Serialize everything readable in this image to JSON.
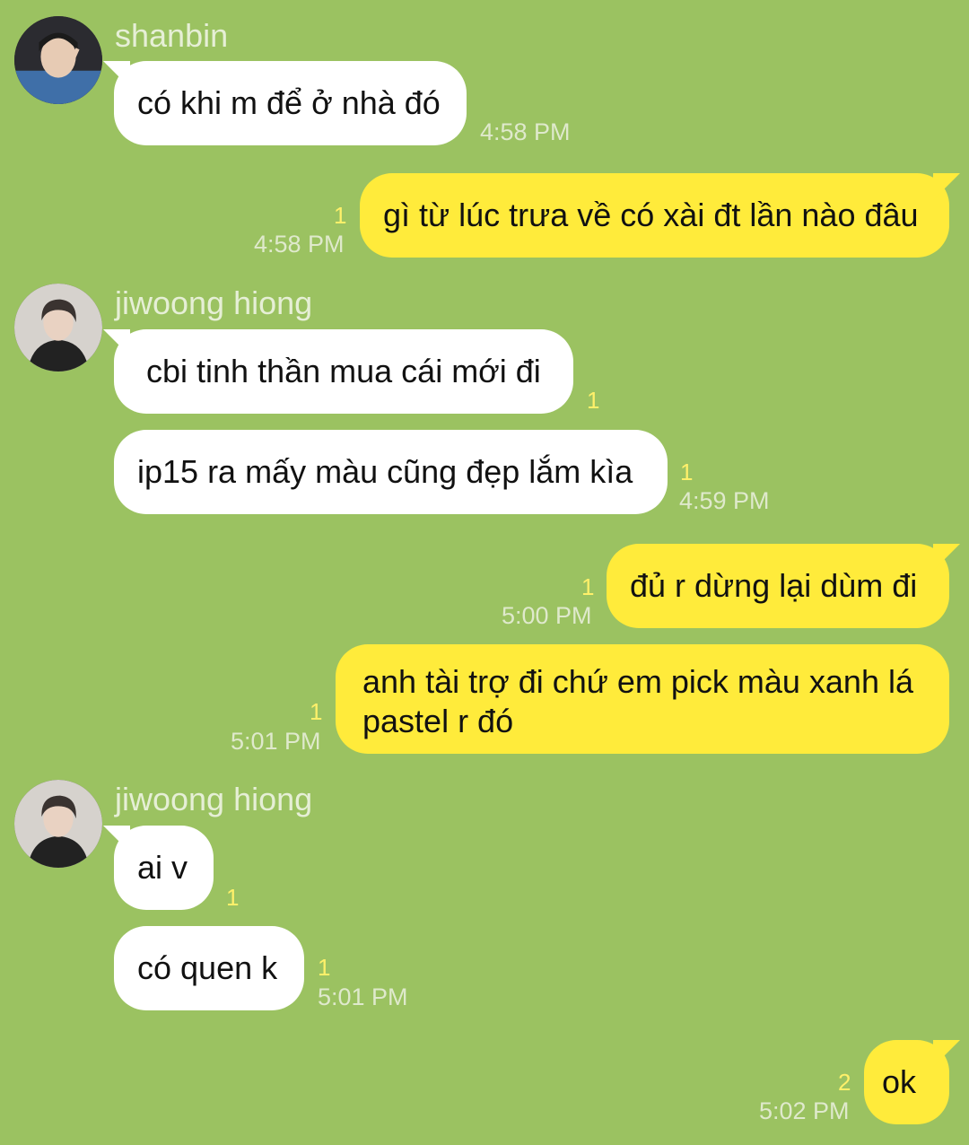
{
  "colors": {
    "background": "#9bc261",
    "incoming_bubble": "#ffffff",
    "outgoing_bubble": "#ffeb3b",
    "sender_name": "#e6efd6",
    "timestamp": "#dfe9cc",
    "read_count": "#fff06a"
  },
  "messages": [
    {
      "direction": "in",
      "sender": "shanbin",
      "avatar_icon": "user-avatar-icon",
      "text": "có khi m để ở nhà đó",
      "time": "4:58 PM",
      "read": ""
    },
    {
      "direction": "out",
      "text": "gì từ lúc trưa về có xài đt lần nào đâu",
      "time": "4:58 PM",
      "read": "1"
    },
    {
      "direction": "in",
      "sender": "jiwoong hiong",
      "avatar_icon": "user-avatar-icon",
      "text": "cbi tinh thần mua cái mới đi",
      "time": "",
      "read": "1"
    },
    {
      "direction": "in",
      "text": "ip15 ra mấy màu cũng đẹp lắm kìa",
      "time": "4:59 PM",
      "read": "1"
    },
    {
      "direction": "out",
      "text": "đủ r dừng lại dùm đi",
      "time": "5:00 PM",
      "read": "1"
    },
    {
      "direction": "out",
      "text": "anh tài trợ đi chứ em pick màu xanh lá pastel r đó",
      "time": "5:01 PM",
      "read": "1"
    },
    {
      "direction": "in",
      "sender": "jiwoong hiong",
      "avatar_icon": "user-avatar-icon",
      "text": "ai v",
      "time": "",
      "read": "1"
    },
    {
      "direction": "in",
      "text": "có quen k",
      "time": "5:01 PM",
      "read": "1"
    },
    {
      "direction": "out",
      "text": "ok",
      "time": "5:02 PM",
      "read": "2"
    }
  ]
}
